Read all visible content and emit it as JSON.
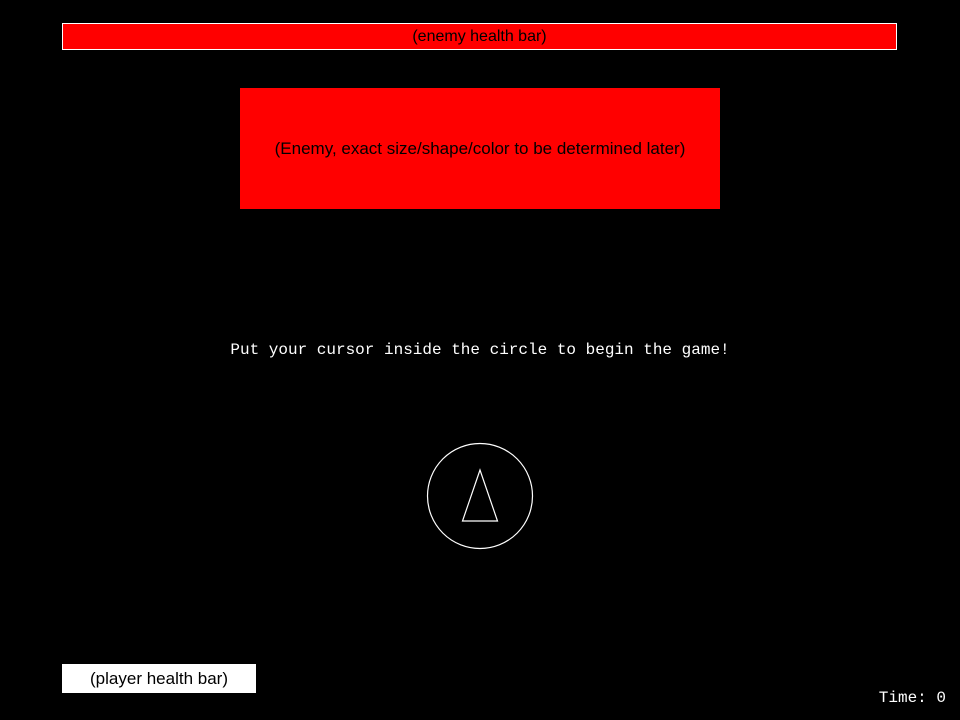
{
  "colors": {
    "background": "#000000",
    "enemy": "#ff0000",
    "enemy_health_bar": "#ff0000",
    "player_health_bar": "#ffffff",
    "text": "#ffffff"
  },
  "enemy_health_bar": {
    "label": "(enemy health bar)",
    "level": 1.0
  },
  "enemy": {
    "label": "(Enemy, exact size/shape/color to be determined later)"
  },
  "instructions": "Put your cursor inside the circle to begin the game!",
  "start_zone": {
    "shape": "circle",
    "player_icon": "triangle-ship-icon"
  },
  "player_health_bar": {
    "label": "(player health bar)",
    "level": 1.0
  },
  "timer": {
    "label": "Time:",
    "value": "0"
  }
}
